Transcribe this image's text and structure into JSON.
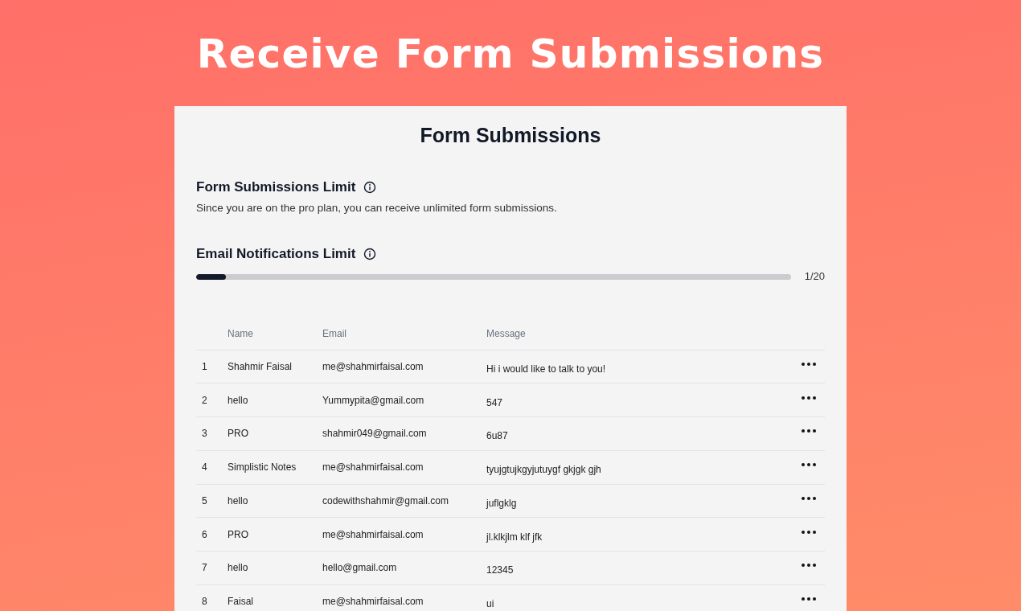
{
  "headline": "Receive Form Submissions",
  "panel": {
    "title": "Form Submissions",
    "submissions_limit": {
      "title": "Form Submissions Limit",
      "description": "Since you are on the pro plan, you can receive unlimited form submissions."
    },
    "email_limit": {
      "title": "Email Notifications Limit",
      "level": 0.05,
      "reading": "1/20"
    },
    "table": {
      "columns": [
        "Name",
        "Email",
        "Message"
      ],
      "rows": [
        {
          "number": "1",
          "name": "Shahmir Faisal",
          "email": "me@shahmirfaisal.com",
          "message": "Hi i would like to talk to you!"
        },
        {
          "number": "2",
          "name": "hello",
          "email": "Yummypita@gmail.com",
          "message": "547"
        },
        {
          "number": "3",
          "name": "PRO",
          "email": "shahmir049@gmail.com",
          "message": "6u87"
        },
        {
          "number": "4",
          "name": "Simplistic Notes",
          "email": "me@shahmirfaisal.com",
          "message": "tyujgtujkgyjutuygf gkjgk gjh"
        },
        {
          "number": "5",
          "name": "hello",
          "email": "codewithshahmir@gmail.com",
          "message": "juflgklg"
        },
        {
          "number": "6",
          "name": "PRO",
          "email": "me@shahmirfaisal.com",
          "message": "jl.klkjlm klf jfk"
        },
        {
          "number": "7",
          "name": "hello",
          "email": "hello@gmail.com",
          "message": "12345"
        },
        {
          "number": "8",
          "name": "Faisal",
          "email": "me@shahmirfaisal.com",
          "message": "ui"
        }
      ]
    }
  }
}
